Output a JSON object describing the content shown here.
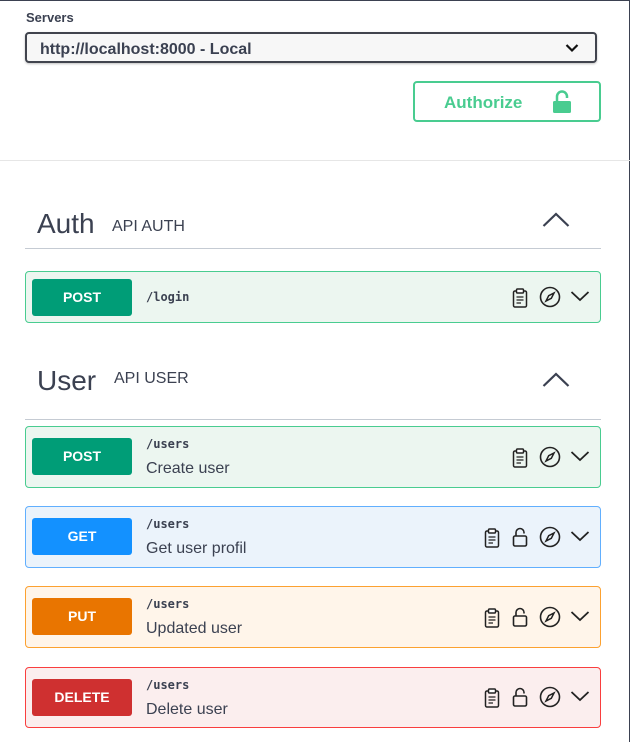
{
  "servers": {
    "title": "Servers",
    "selected": "http://localhost:8000 - Local"
  },
  "authorize": {
    "label": "Authorize"
  },
  "tags": [
    {
      "name": "Auth",
      "description": "API AUTH",
      "operations": [
        {
          "method": "POST",
          "path": "/login",
          "summary": ""
        }
      ]
    },
    {
      "name": "User",
      "description": "API USER",
      "operations": [
        {
          "method": "POST",
          "path": "/users",
          "summary": "Create user"
        },
        {
          "method": "GET",
          "path": "/users",
          "summary": "Get user profil"
        },
        {
          "method": "PUT",
          "path": "/users",
          "summary": "Updated user"
        },
        {
          "method": "DELETE",
          "path": "/users",
          "summary": "Delete user"
        }
      ]
    }
  ],
  "colors": {
    "post": "#009d77",
    "get": "#1391ff",
    "put": "#e97500",
    "delete": "#cf3030",
    "authorize": "#49cc90"
  },
  "icons": {
    "select_arrow": "chevron-down-icon",
    "authorize": "unlocked-icon",
    "tag_toggle": "chevron-up-icon",
    "copy": "clipboard-icon",
    "auth": "unlocked-icon",
    "try": "compass-icon",
    "expand": "chevron-down-icon"
  }
}
